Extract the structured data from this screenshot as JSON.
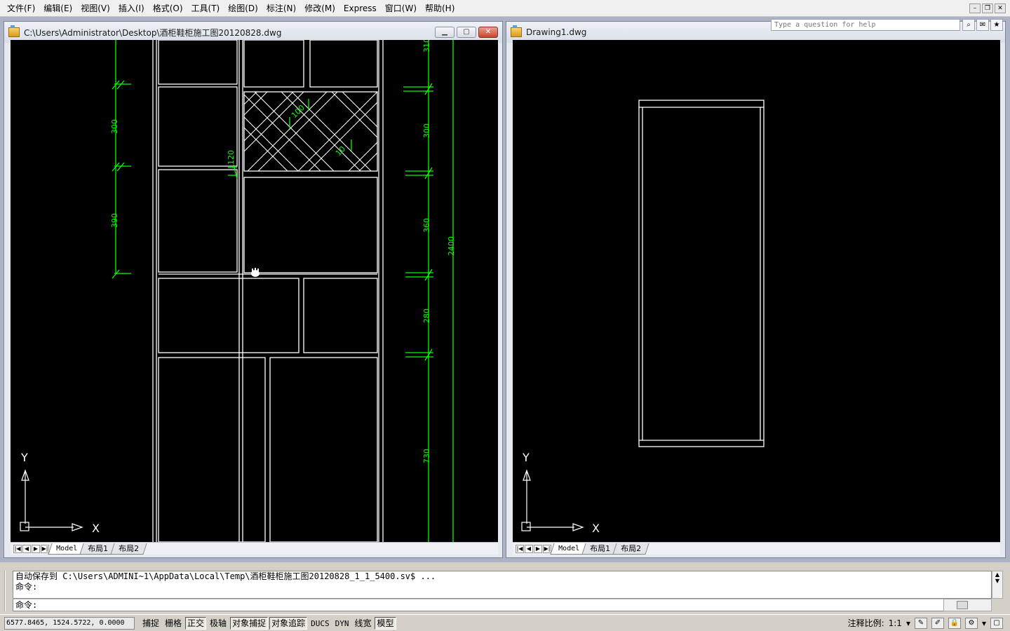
{
  "menu": {
    "items": [
      {
        "id": "file",
        "label": "文件(F)"
      },
      {
        "id": "edit",
        "label": "编辑(E)"
      },
      {
        "id": "view",
        "label": "视图(V)"
      },
      {
        "id": "insert",
        "label": "插入(I)"
      },
      {
        "id": "format",
        "label": "格式(O)"
      },
      {
        "id": "tools",
        "label": "工具(T)"
      },
      {
        "id": "draw",
        "label": "绘图(D)"
      },
      {
        "id": "dimension",
        "label": "标注(N)"
      },
      {
        "id": "modify",
        "label": "修改(M)"
      },
      {
        "id": "express",
        "label": "Express"
      },
      {
        "id": "window",
        "label": "窗口(W)"
      },
      {
        "id": "help",
        "label": "帮助(H)"
      }
    ]
  },
  "help": {
    "placeholder": "Type a question for help"
  },
  "windows": {
    "left": {
      "title": "C:\\Users\\Administrator\\Desktop\\酒柜鞋柜施工图20120828.dwg",
      "tabs": [
        "Model",
        "布局1",
        "布局2"
      ],
      "dims": {
        "d310": "310",
        "d300a": "300",
        "d390": "390",
        "d120": "120",
        "d100": "100",
        "d10": "10",
        "d300b": "300",
        "d360": "360",
        "d2400": "2400",
        "d280": "280",
        "d730": "730"
      },
      "ucs": {
        "x": "X",
        "y": "Y"
      }
    },
    "right": {
      "title": "Drawing1.dwg",
      "tabs": [
        "Model",
        "布局1",
        "布局2"
      ],
      "ucs": {
        "x": "X",
        "y": "Y"
      }
    }
  },
  "command": {
    "history_line1": "自动保存到 C:\\Users\\ADMINI~1\\AppData\\Local\\Temp\\酒柜鞋柜施工图20120828_1_1_5400.sv$ ...",
    "history_line2": "命令:",
    "prompt": "命令:"
  },
  "status": {
    "coords": "6577.8465, 1524.5722, 0.0000",
    "toggles": [
      {
        "id": "snap",
        "label": "捕捉",
        "on": false
      },
      {
        "id": "grid",
        "label": "栅格",
        "on": false
      },
      {
        "id": "ortho",
        "label": "正交",
        "on": true
      },
      {
        "id": "polar",
        "label": "极轴",
        "on": false
      },
      {
        "id": "osnap",
        "label": "对象捕捉",
        "on": true
      },
      {
        "id": "otrack",
        "label": "对象追踪",
        "on": true
      },
      {
        "id": "ducs",
        "label": "DUCS",
        "on": false
      },
      {
        "id": "dyn",
        "label": "DYN",
        "on": false
      },
      {
        "id": "lwt",
        "label": "线宽",
        "on": false
      },
      {
        "id": "model",
        "label": "模型",
        "on": true
      }
    ],
    "anno_label": "注释比例:",
    "anno_value": "1:1"
  },
  "colors": {
    "canvas": "#000000",
    "geometry": "#ffffff",
    "dimension": "#00ff00"
  }
}
